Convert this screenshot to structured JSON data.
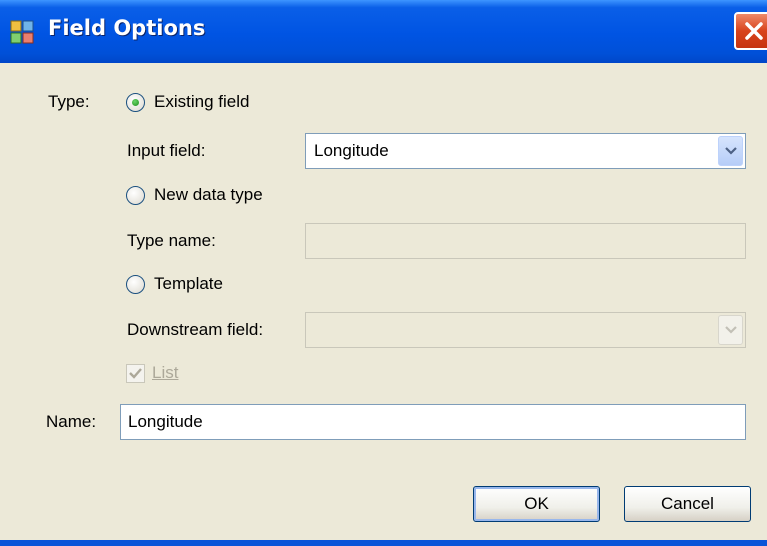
{
  "window": {
    "title": "Field Options"
  },
  "form": {
    "type_label": "Type:",
    "existing_field_label": "Existing field",
    "input_field_label": "Input field:",
    "input_field_value": "Longitude",
    "new_data_type_label": "New data type",
    "type_name_label": "Type name:",
    "type_name_value": "",
    "template_label": "Template",
    "downstream_field_label": "Downstream field:",
    "downstream_field_value": "",
    "list_label": "List",
    "name_label": "Name:",
    "name_value": "Longitude",
    "selected_type": "Existing field",
    "list_checked": true
  },
  "buttons": {
    "ok": "OK",
    "cancel": "Cancel"
  },
  "colors": {
    "titlebar": "#0054e3",
    "client_bg": "#ece9d8",
    "close_button": "#d8431c"
  },
  "icons": {
    "title": "app-icon",
    "close": "close-icon",
    "dropdown": "chevron-down-icon",
    "radio": "radio-icon",
    "check": "checkmark-icon"
  }
}
